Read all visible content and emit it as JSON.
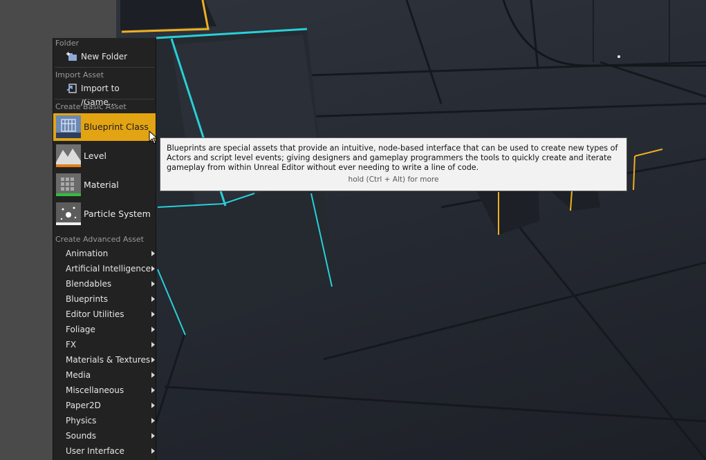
{
  "menu": {
    "sections": {
      "folder": "Folder",
      "import": "Import Asset",
      "basic": "Create Basic Asset",
      "advanced": "Create Advanced Asset"
    },
    "new_folder": {
      "label": "New Folder",
      "icon": "new-folder-icon"
    },
    "import_to": {
      "label": "Import to /Game...",
      "icon": "import-icon"
    },
    "basic_assets": [
      {
        "label": "Blueprint Class",
        "icon": "blueprint-class-icon",
        "highlighted": true
      },
      {
        "label": "Level",
        "icon": "level-icon"
      },
      {
        "label": "Material",
        "icon": "material-icon"
      },
      {
        "label": "Particle System",
        "icon": "particle-system-icon"
      }
    ],
    "advanced_assets": [
      "Animation",
      "Artificial Intelligence",
      "Blendables",
      "Blueprints",
      "Editor Utilities",
      "Foliage",
      "FX",
      "Materials & Textures",
      "Media",
      "Miscellaneous",
      "Paper2D",
      "Physics",
      "Sounds",
      "User Interface"
    ]
  },
  "tooltip": {
    "description": "Blueprints are special assets that provide an intuitive, node-based interface that can be used to create new types of Actors and script level events; giving designers and gameplay programmers the tools to quickly create and iterate gameplay from within Unreal Editor without ever needing to write a line of code.",
    "hint": "hold (Ctrl + Alt) for more"
  },
  "colors": {
    "highlight": "#e3a413",
    "menu_bg": "#222222",
    "accent_cyan": "#28d0d8",
    "accent_yellow": "#f0b020"
  }
}
